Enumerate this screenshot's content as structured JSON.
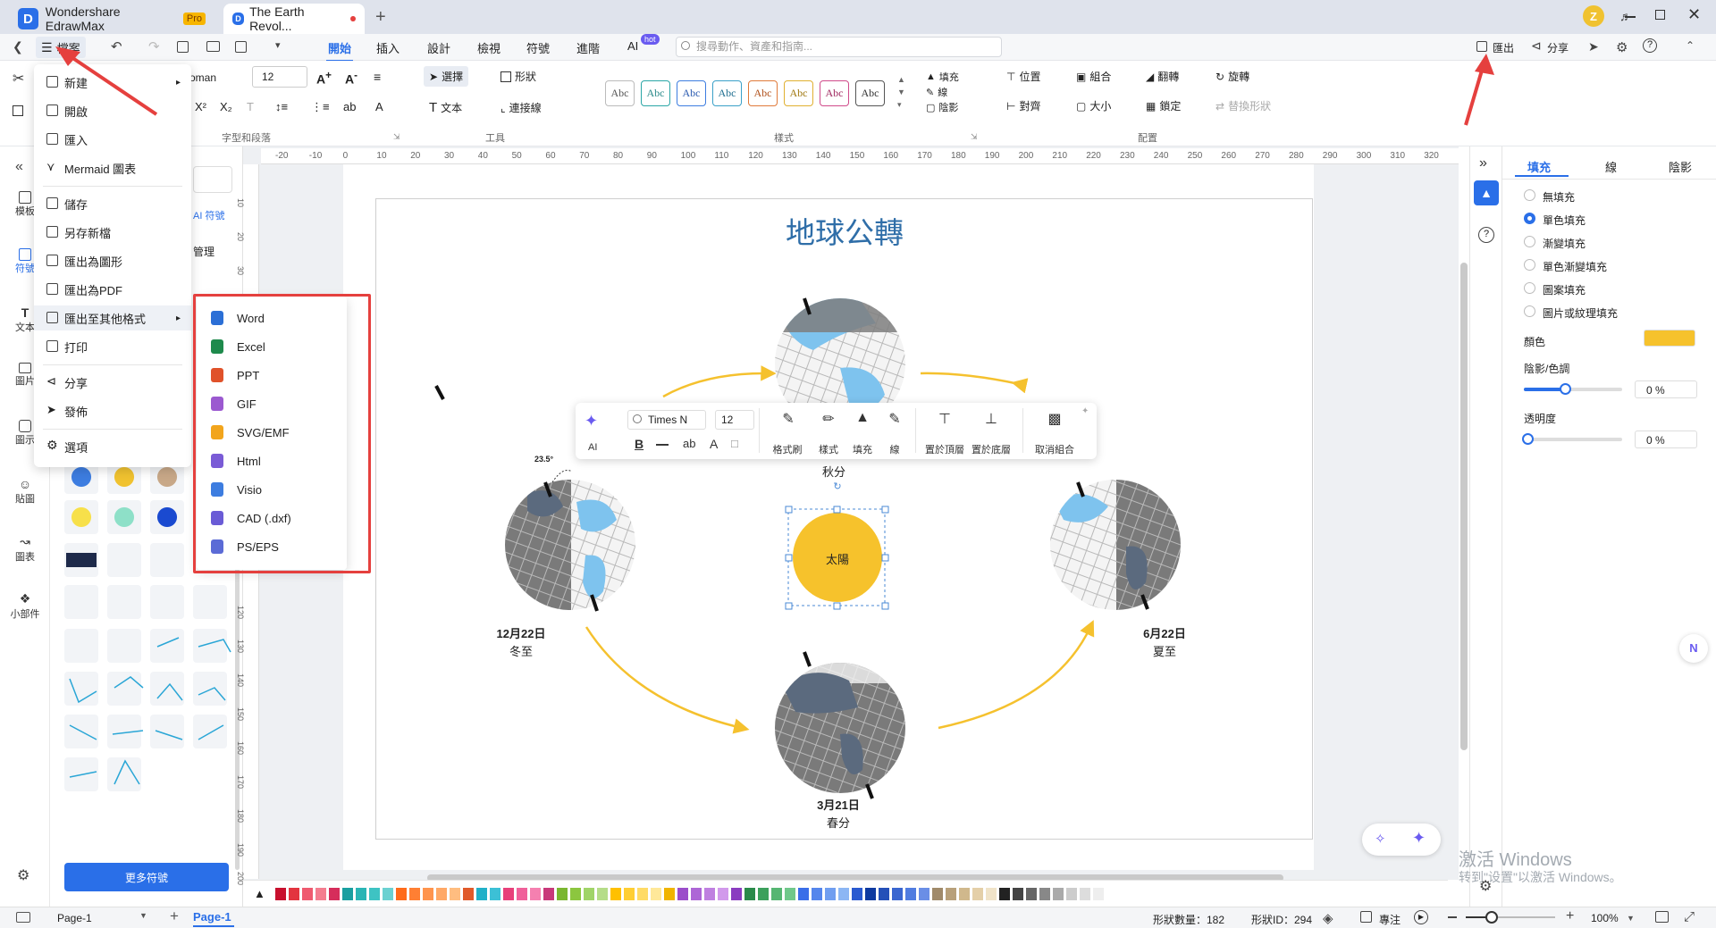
{
  "titlebar": {
    "app_tab": "Wondershare EdrawMax",
    "pro_badge": "Pro",
    "doc_tab": "The Earth Revol...",
    "new_tab": "+",
    "user_initial": "Z"
  },
  "menubar": {
    "file_label": "檔案",
    "tabs": [
      "開始",
      "插入",
      "設計",
      "檢視",
      "符號",
      "進階",
      "AI"
    ],
    "ai_badge": "hot",
    "search_placeholder": "搜尋動作、資產和指南...",
    "export_label": "匯出",
    "share_label": "分享"
  },
  "ribbon": {
    "font_name": "oman",
    "font_size": "12",
    "group_font": "字型和段落",
    "select": "選擇",
    "shape": "形狀",
    "text": "文本",
    "connector": "連接線",
    "group_tools": "工具",
    "style_sample": "Abc",
    "group_style": "樣式",
    "fill": "填充",
    "line": "線",
    "shadow": "陰影",
    "position": "位置",
    "combine": "組合",
    "flip": "翻轉",
    "rotate": "旋轉",
    "align": "對齊",
    "size": "大小",
    "lock": "鎖定",
    "replace_shape": "替換形狀",
    "group_arrange": "配置"
  },
  "left_icons": [
    "模板",
    "符號",
    "文本",
    "圖片",
    "圖示",
    "貼圖",
    "圖表",
    "小部件"
  ],
  "symbol_panel": {
    "ai_symbol": "AI 符號",
    "manage": "管理",
    "more_symbols": "更多符號"
  },
  "file_menu": {
    "items": [
      "新建",
      "開啟",
      "匯入",
      "Mermaid 圖表",
      "儲存",
      "另存新檔",
      "匯出為圖形",
      "匯出為PDF",
      "匯出至其他格式",
      "打印",
      "分享",
      "發佈",
      "選項"
    ]
  },
  "export_submenu": {
    "items": [
      "Word",
      "Excel",
      "PPT",
      "GIF",
      "SVG/EMF",
      "Html",
      "Visio",
      "CAD (.dxf)",
      "PS/EPS"
    ],
    "colors": [
      "#2b6fd6",
      "#1e8a4c",
      "#e0522a",
      "#9b59d0",
      "#f2a51c",
      "#7a5bd6",
      "#3d7de0",
      "#6a5bd6",
      "#5b6bd6"
    ]
  },
  "ruler": {
    "h_ticks": [
      "-20",
      "-10",
      "0",
      "10",
      "20",
      "30",
      "40",
      "50",
      "60",
      "70",
      "80",
      "90",
      "100",
      "110",
      "120",
      "130",
      "140",
      "150",
      "160",
      "170",
      "180",
      "190",
      "200",
      "210",
      "220",
      "230",
      "240",
      "250",
      "260",
      "270",
      "280",
      "290",
      "300",
      "310",
      "320"
    ],
    "v_ticks": [
      "10",
      "20",
      "30",
      "120",
      "130",
      "140",
      "150",
      "160",
      "170",
      "180",
      "190",
      "200"
    ]
  },
  "diagram": {
    "title": "地球公轉",
    "sun": "太陽",
    "tilt": "23.5°",
    "autumn": "秋分",
    "winter_date": "12月22日",
    "winter": "冬至",
    "summer_date": "6月22日",
    "summer": "夏至",
    "spring_date": "3月21日",
    "spring": "春分"
  },
  "float_toolbar": {
    "ai": "AI",
    "font": "Times N",
    "size": "12",
    "format_brush": "格式刷",
    "style": "樣式",
    "fill": "填充",
    "line": "線",
    "to_front": "置於頂層",
    "to_back": "置於底層",
    "ungroup": "取消組合"
  },
  "right_panel": {
    "tabs": [
      "填充",
      "線",
      "陰影"
    ],
    "options": [
      "無填充",
      "單色填充",
      "漸變填充",
      "單色漸變填充",
      "圖案填充",
      "圖片或紋理填充"
    ],
    "color_label": "顏色",
    "color_value": "#f6c22c",
    "shade_label": "陰影/色調",
    "shade_value": "0 %",
    "transparency_label": "透明度",
    "transparency_value": "0 %"
  },
  "palette": [
    "#c8102e",
    "#e3343f",
    "#ef5a6f",
    "#f47d8f",
    "#d62d5b",
    "#1a9fa0",
    "#2ab5b5",
    "#3ec3c3",
    "#6bd1d1",
    "#ff6b1a",
    "#ff7f33",
    "#ff944d",
    "#ffa866",
    "#ffbd80",
    "#e05a2a",
    "#20b0c8",
    "#3cc0d6",
    "#e8407a",
    "#f0609a",
    "#f580b0",
    "#c8387a",
    "#7ab630",
    "#8cc63f",
    "#a0d468",
    "#b5dd88",
    "#ffc000",
    "#ffce33",
    "#ffdb66",
    "#ffe899",
    "#f0b400",
    "#9b4dca",
    "#ad66d6",
    "#bf80e0",
    "#d199eb",
    "#8a3cc0",
    "#2a8a4a",
    "#3ca05c",
    "#56b672",
    "#70c88a",
    "#3a6ee8",
    "#5586ec",
    "#709ef0",
    "#8cb6f4",
    "#2a5ad0",
    "#0e3aa0",
    "#2450b8",
    "#3a66d0",
    "#507ce0",
    "#6a8ee6",
    "#a08a6a",
    "#b8a07a",
    "#d0b88c",
    "#e4cfa8",
    "#f0e3c8",
    "#222222",
    "#444444",
    "#666666",
    "#888888",
    "#aaaaaa",
    "#cccccc",
    "#dddddd",
    "#eeeeee"
  ],
  "status": {
    "page_select": "Page-1",
    "page_tab": "Page-1",
    "shape_count": "形狀數量：182",
    "shape_id": "形狀ID：294",
    "focus": "專注",
    "zoom": "100%"
  },
  "watermark": {
    "line1": "激活 Windows",
    "line2": "转到\"设置\"以激活 Windows。"
  }
}
